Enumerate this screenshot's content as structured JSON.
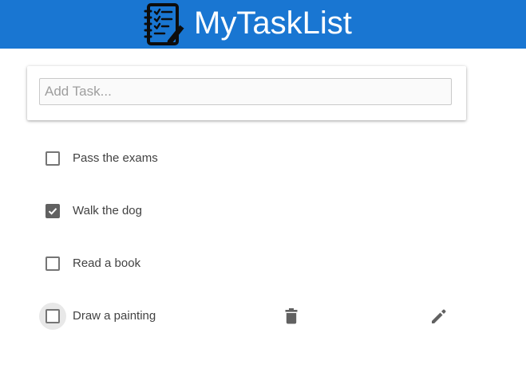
{
  "header": {
    "title": "MyTaskList",
    "logo_icon": "checklist-notebook-icon",
    "background_color": "#1976d2"
  },
  "add_task": {
    "placeholder": "Add Task...",
    "value": ""
  },
  "tasks": [
    {
      "label": "Pass the exams",
      "checked": false
    },
    {
      "label": "Walk the dog",
      "checked": true
    },
    {
      "label": "Read a book",
      "checked": false
    },
    {
      "label": "Draw a painting",
      "checked": false,
      "hovered": true,
      "actions": [
        "delete-icon",
        "edit-icon"
      ]
    }
  ]
}
